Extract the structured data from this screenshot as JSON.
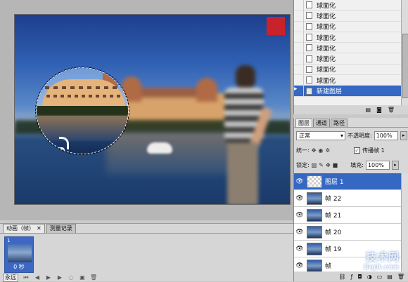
{
  "seal": {
    "text": "扬飞印飞"
  },
  "animation_panel": {
    "tabs": [
      {
        "label": "动画（帧）"
      },
      {
        "label": "测量记录"
      }
    ],
    "frame": {
      "number": "1",
      "time": "0 秒"
    },
    "loop": "永远"
  },
  "history": {
    "items": [
      {
        "label": "球面化"
      },
      {
        "label": "球面化"
      },
      {
        "label": "球面化"
      },
      {
        "label": "球面化"
      },
      {
        "label": "球面化"
      },
      {
        "label": "球面化"
      },
      {
        "label": "球面化"
      },
      {
        "label": "球面化"
      },
      {
        "label": "新建图层"
      }
    ]
  },
  "layers_panel": {
    "tabs": [
      {
        "label": "图层"
      },
      {
        "label": "通道"
      },
      {
        "label": "路径"
      }
    ],
    "blend_mode": "正常",
    "opacity_label": "不透明度:",
    "opacity_value": "100%",
    "unify_label": "统一:",
    "propagate_label": "传播帧 1",
    "lock_label": "锁定:",
    "fill_label": "填充:",
    "fill_value": "100%",
    "layers": [
      {
        "name": "图层 1",
        "selected": true
      },
      {
        "name": "帧 22"
      },
      {
        "name": "帧 21"
      },
      {
        "name": "帧 20"
      },
      {
        "name": "帧 19"
      },
      {
        "name": "帧"
      }
    ]
  },
  "watermark": {
    "text": "技术网",
    "sub": "BigR.com"
  }
}
